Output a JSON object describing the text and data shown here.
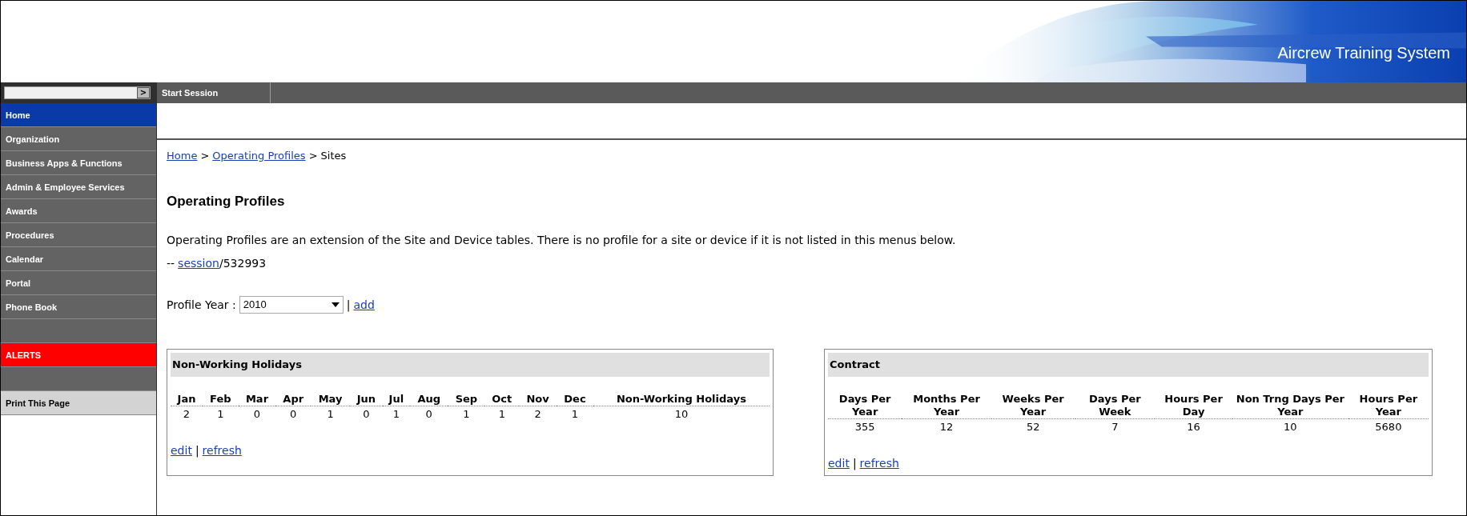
{
  "header": {
    "title": "Aircrew Training System"
  },
  "nav": {
    "search": {
      "button": ">"
    },
    "items": [
      {
        "label": "Start Session"
      }
    ]
  },
  "sidebar": {
    "items": [
      {
        "label": "Home",
        "kind": "link",
        "selected": true
      },
      {
        "label": "Organization",
        "kind": "link",
        "selected": false
      },
      {
        "label": "Business Apps & Functions",
        "kind": "link",
        "selected": false
      },
      {
        "label": "Admin & Employee Services",
        "kind": "link",
        "selected": false
      },
      {
        "label": "Awards",
        "kind": "link",
        "selected": false
      },
      {
        "label": "Procedures",
        "kind": "link",
        "selected": false
      },
      {
        "label": "Calendar",
        "kind": "link",
        "selected": false
      },
      {
        "label": "Portal",
        "kind": "link",
        "selected": false
      },
      {
        "label": "Phone Book",
        "kind": "link",
        "selected": false
      },
      {
        "kind": "spacer"
      },
      {
        "label": "ALERTS",
        "kind": "alert"
      },
      {
        "kind": "spacer"
      },
      {
        "label": "Print This Page",
        "kind": "action"
      }
    ]
  },
  "breadcrumb": [
    {
      "label": "Home",
      "kind": "link"
    },
    {
      "label": "Operating Profiles",
      "kind": "link"
    },
    {
      "label": "Sites",
      "kind": "current"
    }
  ],
  "breadcrumb_separator": ">",
  "page": {
    "title": "Operating Profiles",
    "description": "Operating Profiles are an extension of the Site and Device tables. There is no profile for a site or device if it is not listed in this menus below.",
    "session": {
      "prefix": "--",
      "link": "session",
      "suffix": "/532993"
    },
    "profile_year": {
      "label": "Profile Year :",
      "value": "2010",
      "separator": "|",
      "add": "add"
    }
  },
  "panels": [
    {
      "title": "Non-Working Holidays",
      "columns": [
        "Jan",
        "Feb",
        "Mar",
        "Apr",
        "May",
        "Jun",
        "Jul",
        "Aug",
        "Sep",
        "Oct",
        "Nov",
        "Dec",
        "Non-Working Holidays"
      ],
      "rows": [
        [
          "2",
          "1",
          "0",
          "0",
          "1",
          "0",
          "1",
          "0",
          "1",
          "1",
          "2",
          "1",
          "10"
        ]
      ],
      "links": [
        "edit",
        "refresh"
      ],
      "link_separator": "|"
    },
    {
      "title": "Contract",
      "columns": [
        "Days Per Year",
        "Months Per Year",
        "Weeks Per Year",
        "Days Per Week",
        "Hours Per Day",
        "Non Trng Days Per Year",
        "Hours Per Year"
      ],
      "rows": [
        [
          "355",
          "12",
          "52",
          "7",
          "16",
          "10",
          "5680"
        ]
      ],
      "links": [
        "edit",
        "refresh"
      ],
      "link_separator": "|"
    }
  ]
}
